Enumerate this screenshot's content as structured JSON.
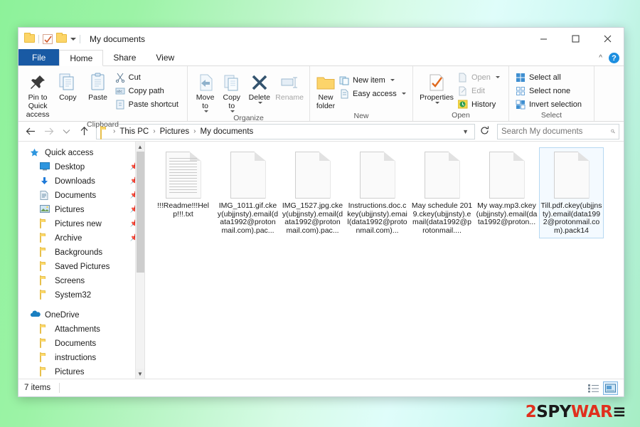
{
  "window": {
    "title": "My documents",
    "quick_access": {
      "folder_icon": "folder-icon",
      "checkbox_icon": "properties-checkbox-icon",
      "new_folder_icon": "new-folder-icon",
      "customize_caret": "chevron-down-icon"
    },
    "controls": {
      "minimize": "─",
      "maximize": "□",
      "close": "✕",
      "collapse_ribbon": "⌃",
      "help": "?"
    }
  },
  "tabs": [
    {
      "label": "File",
      "kind": "file"
    },
    {
      "label": "Home",
      "kind": "active"
    },
    {
      "label": "Share",
      "kind": "normal"
    },
    {
      "label": "View",
      "kind": "normal"
    }
  ],
  "ribbon": {
    "groups": [
      {
        "label": "Clipboard",
        "big": [
          {
            "label": "Pin to Quick access",
            "icon": "pin-icon"
          },
          {
            "label": "Copy",
            "icon": "copy-icon"
          },
          {
            "label": "Paste",
            "icon": "paste-icon"
          }
        ],
        "small": [
          {
            "label": "Cut",
            "icon": "scissors-icon",
            "dim": false
          },
          {
            "label": "Copy path",
            "icon": "copy-path-icon",
            "dim": false
          },
          {
            "label": "Paste shortcut",
            "icon": "paste-shortcut-icon",
            "dim": false
          }
        ]
      },
      {
        "label": "Organize",
        "big": [
          {
            "label": "Move to",
            "icon": "move-to-icon",
            "caret": true
          },
          {
            "label": "Copy to",
            "icon": "copy-to-icon",
            "caret": true
          },
          {
            "label": "Delete",
            "icon": "delete-x-icon",
            "caret": true
          },
          {
            "label": "Rename",
            "icon": "rename-icon",
            "dim": true
          }
        ]
      },
      {
        "label": "New",
        "big": [
          {
            "label": "New folder",
            "icon": "new-folder-icon"
          }
        ],
        "small": [
          {
            "label": "New item",
            "icon": "new-item-icon",
            "caret": true
          },
          {
            "label": "Easy access",
            "icon": "easy-access-icon",
            "caret": true
          }
        ]
      },
      {
        "label": "Open",
        "big": [
          {
            "label": "Properties",
            "icon": "properties-icon",
            "caret": true
          }
        ],
        "small": [
          {
            "label": "Open",
            "icon": "open-icon",
            "caret": true,
            "dim": true
          },
          {
            "label": "Edit",
            "icon": "edit-icon",
            "dim": true
          },
          {
            "label": "History",
            "icon": "history-icon",
            "dim": false
          }
        ]
      },
      {
        "label": "Select",
        "small": [
          {
            "label": "Select all",
            "icon": "select-all-icon"
          },
          {
            "label": "Select none",
            "icon": "select-none-icon"
          },
          {
            "label": "Invert selection",
            "icon": "invert-selection-icon"
          }
        ]
      }
    ]
  },
  "addressbar": {
    "back_icon": "arrow-left-icon",
    "forward_icon": "arrow-right-icon",
    "recent_icon": "chevron-down-icon",
    "up_icon": "arrow-up-icon",
    "path_icon": "folder-icon",
    "breadcrumbs": [
      "This PC",
      "Pictures",
      "My documents"
    ],
    "separator": "›",
    "dropdown_icon": "chevron-down-icon",
    "refresh_icon": "refresh-icon",
    "search": {
      "placeholder": "Search My documents",
      "value": "",
      "icon": "search-icon"
    }
  },
  "navpane": {
    "items": [
      {
        "label": "Quick access",
        "icon": "star-icon",
        "indent": 0,
        "pin": false
      },
      {
        "label": "Desktop",
        "icon": "desktop-icon",
        "indent": 1,
        "pin": true
      },
      {
        "label": "Downloads",
        "icon": "downloads-icon",
        "indent": 1,
        "pin": true
      },
      {
        "label": "Documents",
        "icon": "documents-icon",
        "indent": 1,
        "pin": true
      },
      {
        "label": "Pictures",
        "icon": "pictures-icon",
        "indent": 1,
        "pin": true
      },
      {
        "label": "Pictures new",
        "icon": "folder-icon",
        "indent": 1,
        "pin": true
      },
      {
        "label": "Archive",
        "icon": "folder-icon",
        "indent": 1,
        "pin": true
      },
      {
        "label": "Backgrounds",
        "icon": "folder-icon",
        "indent": 1,
        "pin": false
      },
      {
        "label": "Saved Pictures",
        "icon": "folder-icon",
        "indent": 1,
        "pin": false
      },
      {
        "label": "Screens",
        "icon": "folder-icon",
        "indent": 1,
        "pin": false
      },
      {
        "label": "System32",
        "icon": "folder-icon",
        "indent": 1,
        "pin": false
      },
      {
        "label": "OneDrive",
        "icon": "onedrive-cloud-icon",
        "indent": 0,
        "pin": false
      },
      {
        "label": "Attachments",
        "icon": "folder-icon",
        "indent": 1,
        "pin": false
      },
      {
        "label": "Documents",
        "icon": "folder-icon",
        "indent": 1,
        "pin": false
      },
      {
        "label": "instructions",
        "icon": "folder-icon",
        "indent": 1,
        "pin": false
      },
      {
        "label": "Pictures",
        "icon": "folder-icon",
        "indent": 1,
        "pin": false
      }
    ],
    "scroll_up_icon": "chevron-up-icon",
    "scroll_down_icon": "chevron-down-icon"
  },
  "files": [
    {
      "name": "!!!Readme!!!Help!!!.txt",
      "icon": "text-file-icon",
      "selected": false
    },
    {
      "name": "IMG_1011.gif.ckey(ubjjnsty).email(data1992@protonmail.com).pac...",
      "icon": "blank-file-icon",
      "selected": false
    },
    {
      "name": "IMG_1527.jpg.ckey(ubjjnsty).email(data1992@protonmail.com).pac...",
      "icon": "blank-file-icon",
      "selected": false
    },
    {
      "name": "Instructions.doc.ckey(ubjjnsty).email(data1992@protonmail.com)...",
      "icon": "blank-file-icon",
      "selected": false
    },
    {
      "name": "May schedule 2019.ckey(ubjjnsty).email(data1992@protonmail....",
      "icon": "blank-file-icon",
      "selected": false
    },
    {
      "name": "My way.mp3.ckey(ubjjnsty).email(data1992@proton...",
      "icon": "blank-file-icon",
      "selected": false
    },
    {
      "name": "Till.pdf.ckey(ubjjnsty).email(data1992@protonmail.com).pack14",
      "icon": "blank-file-icon",
      "selected": true
    }
  ],
  "statusbar": {
    "item_count": "7 items",
    "views": [
      {
        "icon": "details-view-icon",
        "active": false
      },
      {
        "icon": "large-icons-view-icon",
        "active": true
      }
    ]
  },
  "watermark": {
    "part1": "2",
    "part2": "SPY",
    "part3": "WAR",
    "part4": "≡"
  },
  "colors": {
    "file_tab": "#195aa4",
    "selection": "#b6d8f2",
    "accent_watermark_red": "#e0301e",
    "folder_yellow": "#fcd96b"
  }
}
